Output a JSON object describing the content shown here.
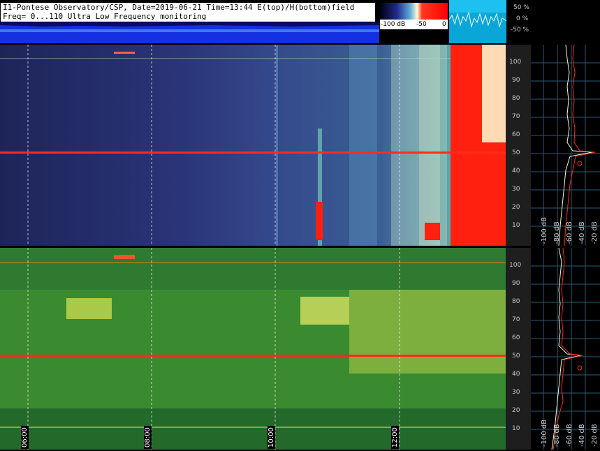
{
  "header": {
    "line1": "I1-Pontese Observatory/CSP, Date=2019-06-21 Time=13:44 E(top)/H(bottom)field",
    "line2": "Freq= 0...110 Ultra Low Frequency monitoring"
  },
  "colorbar": {
    "min_label": "-100 dB",
    "mid_label": "-50",
    "max_label": "0"
  },
  "amplitude_scale": [
    "50 %",
    "0 %",
    "-50 %"
  ],
  "freq_ticks": [
    "100",
    "90",
    "80",
    "70",
    "60",
    "50",
    "40",
    "30",
    "20",
    "10"
  ],
  "time_labels": [
    "06:00",
    "08:00",
    "10:00",
    "12:00"
  ],
  "spectrum_db_labels": [
    "-100 dB",
    "-80 dB",
    "-60 dB",
    "-40 dB",
    "-20 dB"
  ],
  "colors": {
    "e_panel_bg": "#2a3470",
    "h_panel_bg": "#2f7d2c",
    "mains_line": "#ff2a1a",
    "trace_white": "#f2ffd8",
    "trace_red": "#ff2a1a",
    "grid": "#3a6d8a"
  }
}
